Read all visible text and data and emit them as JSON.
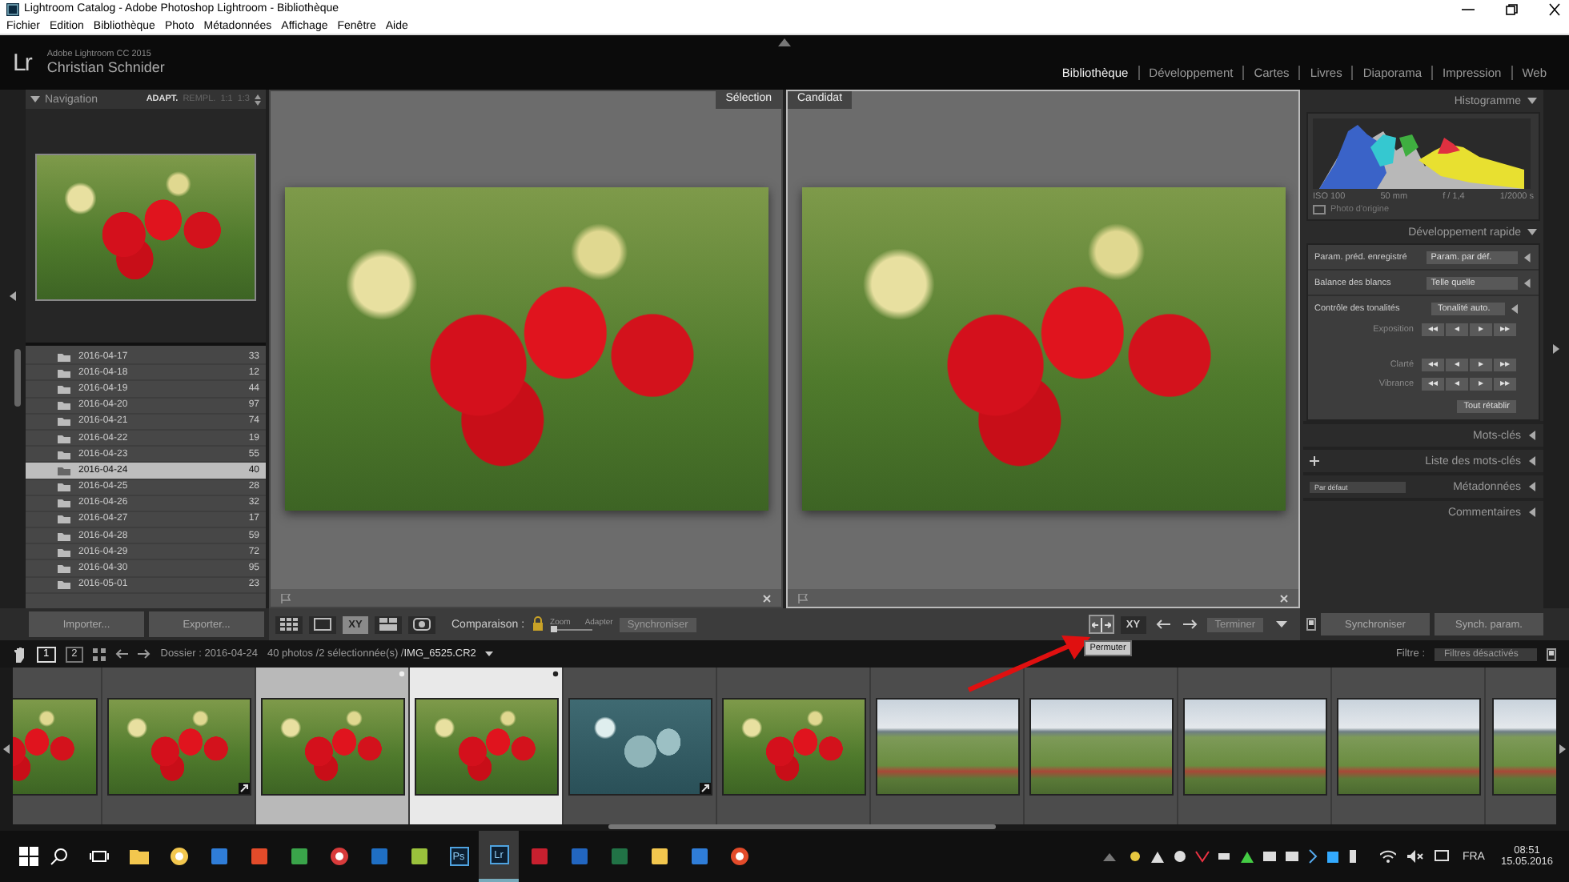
{
  "window": {
    "title": "Lightroom Catalog - Adobe Photoshop Lightroom - Bibliothèque"
  },
  "menu": [
    "Fichier",
    "Edition",
    "Bibliothèque",
    "Photo",
    "Métadonnées",
    "Affichage",
    "Fenêtre",
    "Aide"
  ],
  "identity": {
    "logo": "Lr",
    "product": "Adobe Lightroom CC 2015",
    "user": "Christian Schnider"
  },
  "modules": [
    {
      "label": "Bibliothèque",
      "selected": true
    },
    {
      "label": "Développement",
      "selected": false
    },
    {
      "label": "Cartes",
      "selected": false
    },
    {
      "label": "Livres",
      "selected": false
    },
    {
      "label": "Diaporama",
      "selected": false
    },
    {
      "label": "Impression",
      "selected": false
    },
    {
      "label": "Web",
      "selected": false
    }
  ],
  "navigator": {
    "title": "Navigation",
    "zoom_options": [
      {
        "label": "ADAPT.",
        "selected": true
      },
      {
        "label": "REMPL.",
        "selected": false
      },
      {
        "label": "1:1",
        "selected": false
      },
      {
        "label": "1:3",
        "selected": false
      }
    ]
  },
  "folders": [
    {
      "name": "2016-04-17",
      "count": "33",
      "selected": false
    },
    {
      "name": "2016-04-18",
      "count": "12",
      "selected": false
    },
    {
      "name": "2016-04-19",
      "count": "44",
      "selected": false
    },
    {
      "name": "2016-04-20",
      "count": "97",
      "selected": false
    },
    {
      "name": "2016-04-21",
      "count": "74",
      "selected": false
    },
    {
      "name": "2016-04-22",
      "count": "19",
      "selected": false
    },
    {
      "name": "2016-04-23",
      "count": "55",
      "selected": false
    },
    {
      "name": "2016-04-24",
      "count": "40",
      "selected": true
    },
    {
      "name": "2016-04-25",
      "count": "28",
      "selected": false
    },
    {
      "name": "2016-04-26",
      "count": "32",
      "selected": false
    },
    {
      "name": "2016-04-27",
      "count": "17",
      "selected": false
    },
    {
      "name": "2016-04-28",
      "count": "59",
      "selected": false
    },
    {
      "name": "2016-04-29",
      "count": "72",
      "selected": false
    },
    {
      "name": "2016-04-30",
      "count": "95",
      "selected": false
    },
    {
      "name": "2016-05-01",
      "count": "23",
      "selected": false
    }
  ],
  "left_buttons": [
    "Importer...",
    "Exporter..."
  ],
  "compare": {
    "panes": [
      {
        "label": "Sélection",
        "kind": "select"
      },
      {
        "label": "Candidat",
        "kind": "candidate"
      }
    ]
  },
  "histogram": {
    "title": "Histogramme",
    "readings": [
      "ISO 100",
      "50 mm",
      "f / 1,4",
      "1/2000 s"
    ],
    "original_photo": {
      "label": "Photo d'origine",
      "checked": false
    }
  },
  "quick_develop": {
    "title": "Développement rapide",
    "rows": [
      {
        "label": "Param. préd. enregistré",
        "value": "Param. par déf."
      },
      {
        "label": "Balance des blancs",
        "value": "Telle quelle"
      }
    ],
    "tone": {
      "label": "Contrôle des tonalités",
      "button": "Tonalité auto."
    },
    "adjustments": [
      "Exposition",
      "Clarté",
      "Vibrance"
    ],
    "steps": [
      "◂◂",
      "◂",
      "▸",
      "▸▸"
    ],
    "reset": "Tout rétablir"
  },
  "panels": [
    {
      "title": "Mots-clés",
      "kind": "plain"
    },
    {
      "title": "Liste des mots-clés",
      "kind": "add"
    },
    {
      "title": "Métadonnées",
      "kind": "preset",
      "preset": "Par défaut"
    },
    {
      "title": "Commentaires",
      "kind": "plain"
    }
  ],
  "right_buttons": [
    "Synchroniser",
    "Synch. param."
  ],
  "toolbar": {
    "view_modes": [
      {
        "kind": "grid",
        "selected": false
      },
      {
        "kind": "loupe",
        "selected": false
      },
      {
        "kind": "compare",
        "selected": true,
        "label": "XY"
      },
      {
        "kind": "survey",
        "selected": false
      },
      {
        "kind": "people",
        "selected": false
      }
    ],
    "comparison_label": "Comparaison :",
    "zoom_label": "Zoom",
    "zoom": {
      "level": 0
    },
    "fit_label": "Adapter",
    "sync": "Synchroniser",
    "swap_tooltip": "Permuter",
    "select_label": "XY",
    "done": "Terminer"
  },
  "filmstrip_bar": {
    "monitors": [
      {
        "label": "1",
        "selected": true
      },
      {
        "label": "2",
        "selected": false
      }
    ],
    "source": "Dossier : 2016-04-24",
    "info": "40 photos /2 sélectionnée(s) /",
    "file": "IMG_6525.CR2",
    "filter_label": "Filtre :",
    "filter": "Filtres désactivés"
  },
  "filmstrip": [
    {
      "kind": "tulip",
      "selected": false,
      "primary": false,
      "edited": false
    },
    {
      "kind": "tulip",
      "selected": false,
      "primary": false,
      "edited": true
    },
    {
      "kind": "tulip",
      "selected": true,
      "primary": false,
      "edited": false
    },
    {
      "kind": "tulip",
      "selected": true,
      "primary": true,
      "edited": false
    },
    {
      "kind": "toned",
      "selected": false,
      "primary": false,
      "edited": true
    },
    {
      "kind": "tulip",
      "selected": false,
      "primary": false,
      "edited": false
    },
    {
      "kind": "landscape",
      "selected": false,
      "primary": false,
      "edited": false
    },
    {
      "kind": "landscape",
      "selected": false,
      "primary": false,
      "edited": false
    },
    {
      "kind": "landscape",
      "selected": false,
      "primary": false,
      "edited": false
    },
    {
      "kind": "landscape",
      "selected": false,
      "primary": false,
      "edited": false
    },
    {
      "kind": "landscape",
      "selected": false,
      "primary": false,
      "edited": false
    }
  ],
  "taskbar": {
    "apps": [
      {
        "kind": "search",
        "active": false
      },
      {
        "kind": "taskview",
        "active": false
      },
      {
        "kind": "folder",
        "active": false
      },
      {
        "kind": "browser",
        "active": false
      },
      {
        "kind": "app",
        "active": false
      },
      {
        "kind": "app",
        "active": false
      },
      {
        "kind": "app",
        "active": false
      },
      {
        "kind": "browser",
        "active": false
      },
      {
        "kind": "app",
        "active": false
      },
      {
        "kind": "app",
        "active": false
      },
      {
        "kind": "lettered",
        "label": "Ps",
        "active": false
      },
      {
        "kind": "lettered",
        "label": "Lr",
        "active": true
      },
      {
        "kind": "app",
        "active": false
      },
      {
        "kind": "app",
        "active": false
      },
      {
        "kind": "app",
        "active": false
      },
      {
        "kind": "app",
        "active": false
      },
      {
        "kind": "app",
        "active": false
      },
      {
        "kind": "browser",
        "active": false
      }
    ],
    "language": "FRA",
    "time": "08:51",
    "date": "15.05.2016"
  }
}
